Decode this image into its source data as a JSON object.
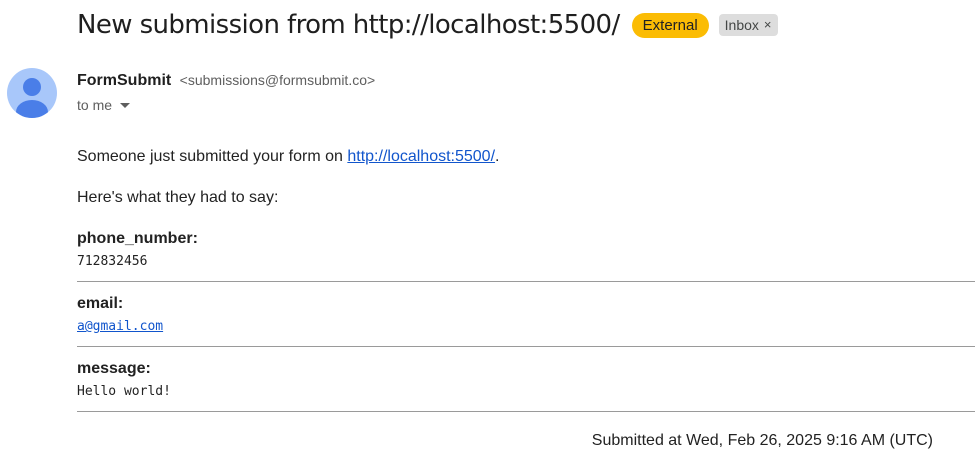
{
  "email": {
    "subject": "New submission from http://localhost:5500/",
    "labels": {
      "external": "External",
      "inbox": "Inbox",
      "inbox_close": "×"
    },
    "sender": {
      "name": "FormSubmit",
      "address": "<submissions@formsubmit.co>"
    },
    "recipient": "to me",
    "body": {
      "intro_prefix": "Someone just submitted your form on ",
      "intro_link": "http://localhost:5500/",
      "intro_suffix": ".",
      "lead": "Here's what they had to say:",
      "fields": [
        {
          "label": "phone_number:",
          "value": "712832456"
        },
        {
          "label": "email:",
          "value": "a@gmail.com"
        },
        {
          "label": "message:",
          "value": "Hello world!"
        }
      ],
      "footer": "Submitted at Wed, Feb 26, 2025 9:16 AM (UTC)"
    }
  },
  "colors": {
    "external_badge": "#fbbc04",
    "inbox_badge": "#dddddd",
    "link": "#1155cc",
    "avatar_bg": "#a8c7fa",
    "avatar_fg": "#4a7ee8"
  },
  "icons": {
    "avatar": "person-icon",
    "recipient_caret": "caret-down-icon",
    "label_close": "close-icon"
  }
}
